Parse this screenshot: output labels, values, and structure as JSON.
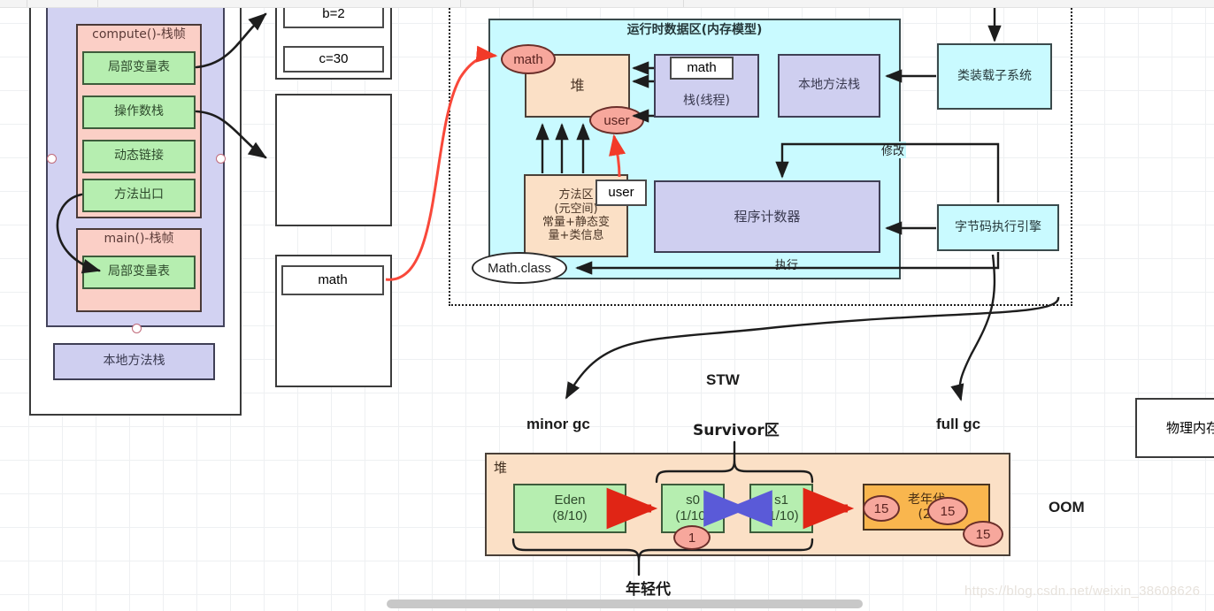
{
  "watermark": "https://blog.csdn.net/weixin_38608626",
  "jvm_stack_panel": {
    "compute_frame_title": "compute()-栈帧",
    "compute_frame_items": [
      "局部变量表",
      "操作数栈",
      "动态链接",
      "方法出口"
    ],
    "main_frame_title": "main()-栈帧",
    "main_frame_items": [
      "局部变量表"
    ],
    "native_stack": "本地方法栈"
  },
  "variables_panel": {
    "slots": [
      "b=2",
      "c=30"
    ],
    "object_ref": "math"
  },
  "runtime_area": {
    "title": "运行时数据区(内存模型)",
    "heap_label": "堆",
    "heap_obj_math": "math",
    "heap_obj_user": "user",
    "stack_label": "栈(线程)",
    "stack_frame_label": "math",
    "native_stack_label": "本地方法栈",
    "method_area_line1": "方法区",
    "method_area_line2": "(元空间)",
    "method_area_line3": "常量+静态变",
    "method_area_line4": "量+类信息",
    "method_area_user_ref": "user",
    "math_class": "Math.class",
    "pc_register": "程序计数器",
    "edge_modify": "修改",
    "edge_execute": "执行"
  },
  "right_column": {
    "class_loader": "类装载子系统",
    "execution_engine": "字节码执行引擎"
  },
  "gc_section": {
    "stw": "STW",
    "minor_gc": "minor gc",
    "full_gc": "full gc",
    "survivor_label": "Survivor区",
    "young_gen_label": "年轻代",
    "oom": "OOM",
    "heap_label": "堆",
    "regions": [
      {
        "name": "Eden",
        "ratio": "(8/10)"
      },
      {
        "name": "s0",
        "ratio": "(1/10)"
      },
      {
        "name": "s1",
        "ratio": "(1/10)"
      }
    ],
    "old_gen_line1": "老年代",
    "old_gen_line2": "(2/",
    "age_badges": [
      "1",
      "15",
      "15",
      "15"
    ]
  },
  "physical_memory": {
    "label": "物理内存"
  },
  "colors": {
    "cyan": "#c9faff",
    "purple": "#d2d2f2",
    "pink": "#fbcfc6",
    "green": "#b6eeb0",
    "peach": "#fbe0c6",
    "orange": "#f9b64e",
    "red_arrow": "#f23a28",
    "blue_arrow": "#6a6ae0",
    "bubble_red": "#f7a79c"
  }
}
